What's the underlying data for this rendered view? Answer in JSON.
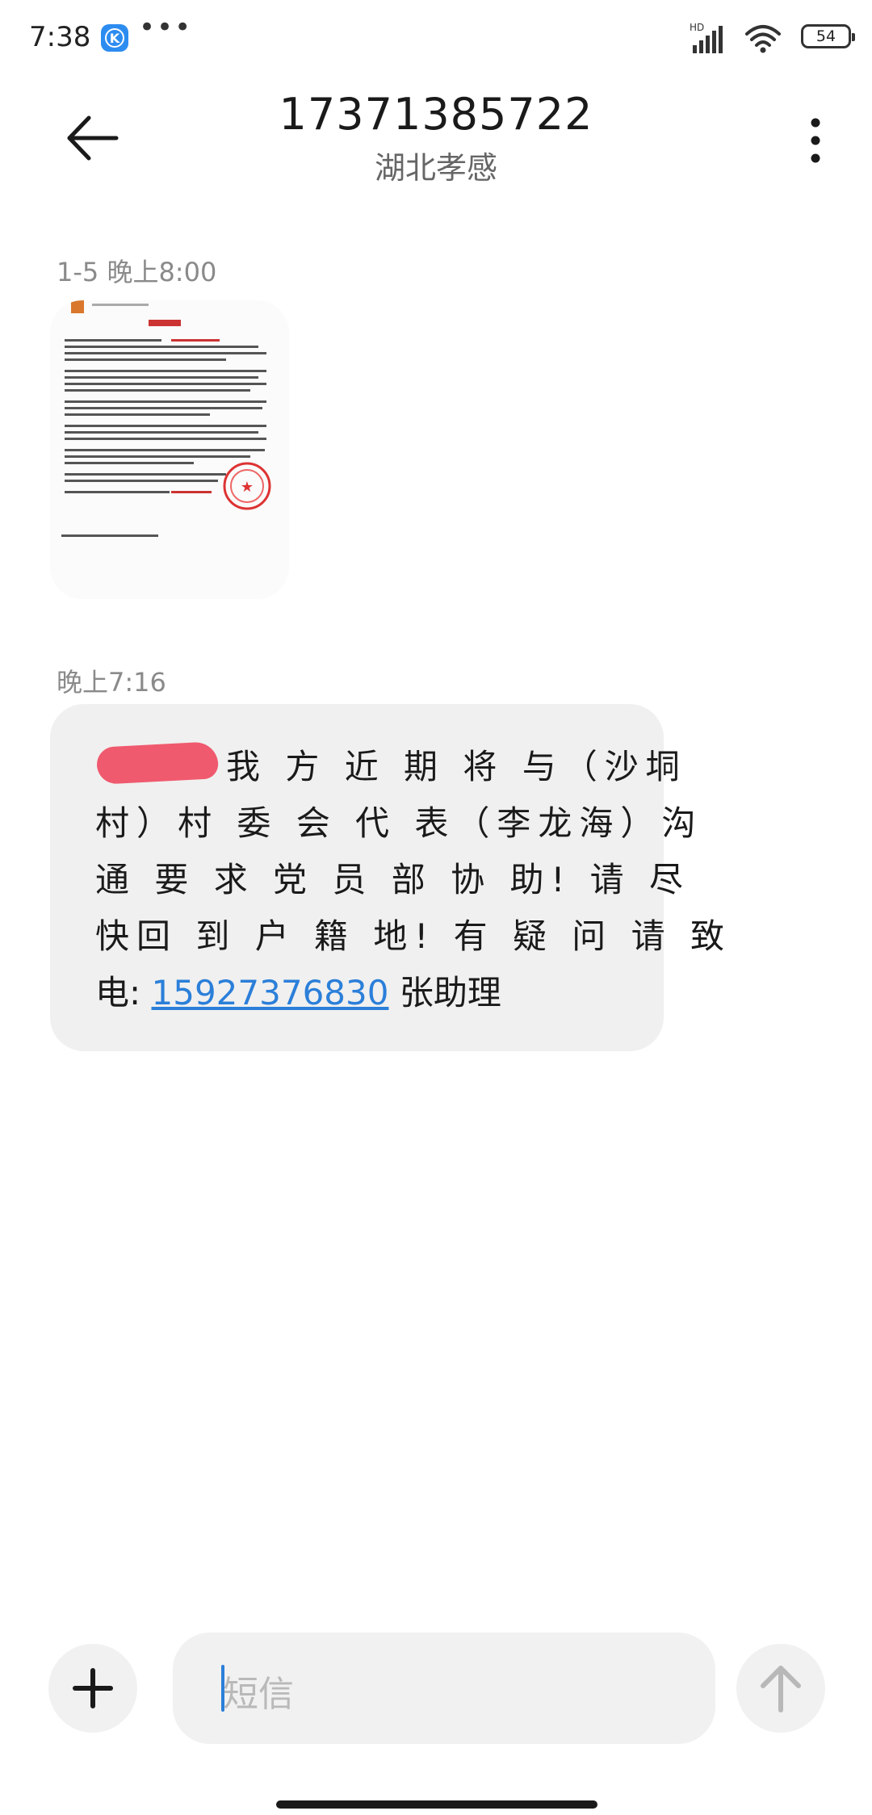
{
  "status_bar": {
    "time": "7:38",
    "app_badge_letter": "K",
    "more_dots": "•••",
    "network_label": "HD",
    "battery": "54"
  },
  "header": {
    "phone_number": "17371385722",
    "location": "湖北孝感"
  },
  "messages": [
    {
      "timestamp": "1-5 晚上8:00",
      "type": "image"
    },
    {
      "timestamp": "晚上7:16",
      "type": "text",
      "lines": [
        "我 方 近 期 将 与（沙垌",
        "村）村  委 会 代 表（李龙海）沟",
        "通  要  求 党 员 部 协 助! 请 尽",
        "快回 到 户 籍 地! 有 疑 问 请 致"
      ],
      "last_line_prefix": "电: ",
      "phone_link": "15927376830",
      "last_line_suffix": " 张助理"
    }
  ],
  "composer": {
    "placeholder": "短信"
  },
  "colors": {
    "link": "#2b7fd9",
    "redaction": "#f05a6e",
    "bubble": "#f0f0f0"
  },
  "icons": {
    "back": "arrow-left-icon",
    "more": "more-vertical-icon",
    "add": "plus-icon",
    "send": "arrow-up-icon"
  }
}
